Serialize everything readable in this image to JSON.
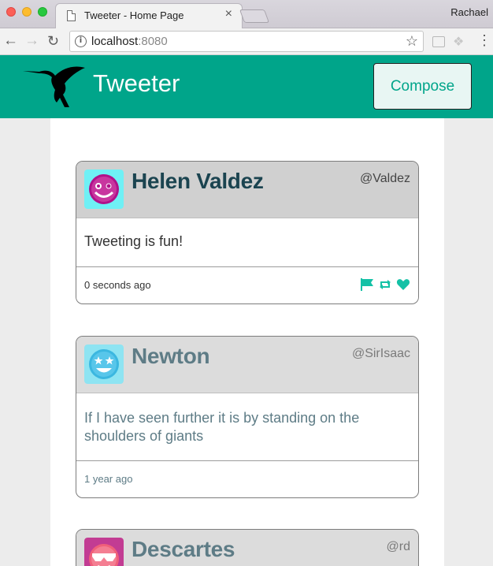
{
  "browser": {
    "tab_title": "Tweeter - Home Page",
    "tab_close": "×",
    "user": "Rachael",
    "url_host": "localhost",
    "url_port": ":8080"
  },
  "app": {
    "title": "Tweeter",
    "compose_label": "Compose",
    "accent_color": "#00a58a"
  },
  "tweets": [
    {
      "author": "Helen Valdez",
      "handle": "@Valdez",
      "text": "Tweeting is fun!",
      "time": "0 seconds ago",
      "avatar_icon": "smiley-face-icon",
      "actions": [
        "flag-icon",
        "retweet-icon",
        "heart-icon"
      ]
    },
    {
      "author": "Newton",
      "handle": "@SirIsaac",
      "text": "If I have seen further it is by standing on the shoulders of giants",
      "time": "1 year ago",
      "avatar_icon": "star-eyes-face-icon"
    },
    {
      "author": "Descartes",
      "handle": "@rd",
      "avatar_icon": "sunglasses-face-icon"
    }
  ]
}
